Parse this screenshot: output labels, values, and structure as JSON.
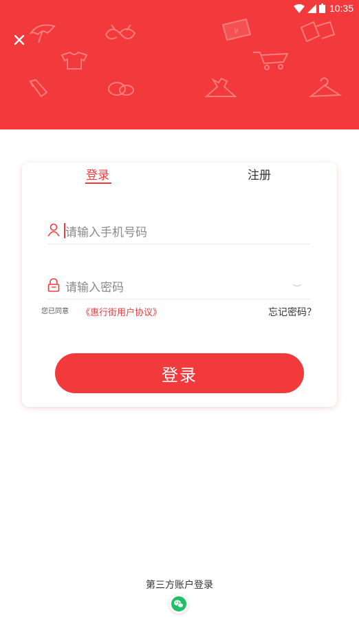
{
  "status_bar": {
    "time": "10:35"
  },
  "header": {
    "background_color": "#f2393b",
    "close_icon": "close-icon"
  },
  "tabs": [
    {
      "label": "登录",
      "active": true
    },
    {
      "label": "注册",
      "active": false
    }
  ],
  "form": {
    "phone_placeholder": "请输入手机号码",
    "password_placeholder": "请输入密码",
    "agree_prefix": "您已同意",
    "agreement_link": "《惠行街用户协议》",
    "forgot_password": "忘记密码？",
    "submit_label": "登录"
  },
  "third_party": {
    "title": "第三方账户登录",
    "icon": "wechat-icon"
  },
  "accent_color": "#f2393b"
}
